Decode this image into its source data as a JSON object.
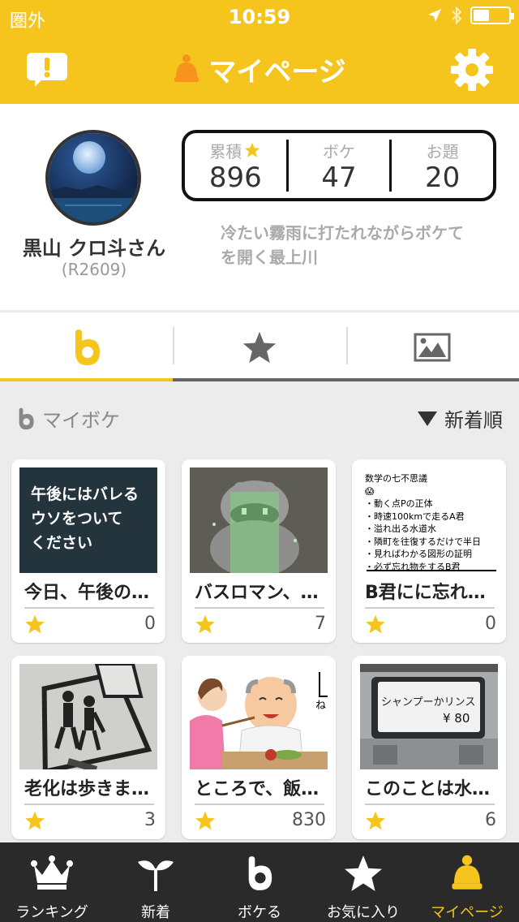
{
  "status": {
    "carrier": "圏外",
    "time": "10:59",
    "battery_level": 0.45
  },
  "header": {
    "title": "マイページ",
    "feedback_icon": "exclamation-bubble-icon",
    "settings_icon": "gear-icon"
  },
  "profile": {
    "name": "黒山 クロ斗さん",
    "id": "(R2609)",
    "stats": [
      {
        "label": "累積",
        "value": "896"
      },
      {
        "label": "ボケ",
        "value": "47"
      },
      {
        "label": "お題",
        "value": "20"
      }
    ],
    "bio": "冷たい霧雨に打たれながらボケてを開く最上川"
  },
  "tabs": [
    {
      "icon": "boke-icon",
      "active": true
    },
    {
      "icon": "star-icon",
      "active": false
    },
    {
      "icon": "image-icon",
      "active": false
    }
  ],
  "section": {
    "title": "マイボケ",
    "sort": "新着順"
  },
  "cards": [
    {
      "title": "今日、午後の…",
      "count": "0",
      "thumb_text": [
        "午後にはバレる",
        "ウソをついて",
        "ください"
      ]
    },
    {
      "title": "バスロマン、…",
      "count": "7"
    },
    {
      "title": "B君にに忘れ…",
      "count": "0",
      "thumb_text": [
        "数学の七不思議",
        "😱",
        "・動く点Pの正体",
        "・時速100kmで走るA君",
        "・溢れ出る水道水",
        "・隣町を往復するだけで半日",
        "・見ればわかる図形の証明",
        "・必ず忘れ物をするB君"
      ]
    },
    {
      "title": "老化は歩きま…",
      "count": "3"
    },
    {
      "title": "ところで、飯…",
      "count": "830",
      "thumb_text": [
        "ね"
      ]
    },
    {
      "title": "このことは水…",
      "count": "6",
      "thumb_text": [
        "シャンプーかリンス",
        "¥ 80"
      ]
    }
  ],
  "nav": [
    {
      "label": "ランキング",
      "icon": "crown-icon"
    },
    {
      "label": "新着",
      "icon": "sprout-icon"
    },
    {
      "label": "ボケる",
      "icon": "boke-icon"
    },
    {
      "label": "お気に入り",
      "icon": "star-icon"
    },
    {
      "label": "マイページ",
      "icon": "mypage-bell-icon",
      "active": true
    }
  ],
  "colors": {
    "accent": "#f5c51e",
    "nav_bg": "#2a2a2a",
    "star": "#f5c51e"
  }
}
